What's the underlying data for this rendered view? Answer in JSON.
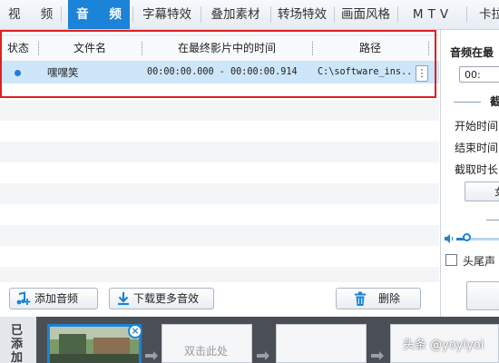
{
  "tabs": [
    {
      "label": "视 频",
      "active": false
    },
    {
      "label": "音 频",
      "active": true
    },
    {
      "label": "字幕特效",
      "active": false
    },
    {
      "label": "叠加素材",
      "active": false
    },
    {
      "label": "转场特效",
      "active": false
    },
    {
      "label": "画面风格",
      "active": false
    },
    {
      "label": "MTV",
      "active": false
    },
    {
      "label": "卡拉",
      "active": false
    }
  ],
  "table": {
    "headers": [
      "状态",
      "文件名",
      "在最终影片中的时间",
      "路径"
    ],
    "rows": [
      {
        "status_icon": "blue-dot",
        "filename": "嘿嘿笑",
        "time": "00:00:00.000 - 00:00:00.914",
        "path": "C:\\software_ins..",
        "more": "⋮"
      }
    ]
  },
  "buttons": {
    "add_audio": "添加音频",
    "download_more": "下载更多音效",
    "delete": "删除"
  },
  "right_panel": {
    "title": "音频在最",
    "time_value": "00:",
    "section": "截",
    "start_label": "开始时间",
    "end_label": "结束时间",
    "duration_label": "截取时长",
    "btn1": "女",
    "fade_label": "头尾声"
  },
  "bottom": {
    "added_label": [
      "已",
      "添",
      "加"
    ],
    "placeholder": "双击此处"
  },
  "watermark": "头条 @yoyiyoi",
  "colors": {
    "accent": "#1b83d8",
    "selection": "#cde6f9",
    "highlight_box": "#e02020"
  }
}
